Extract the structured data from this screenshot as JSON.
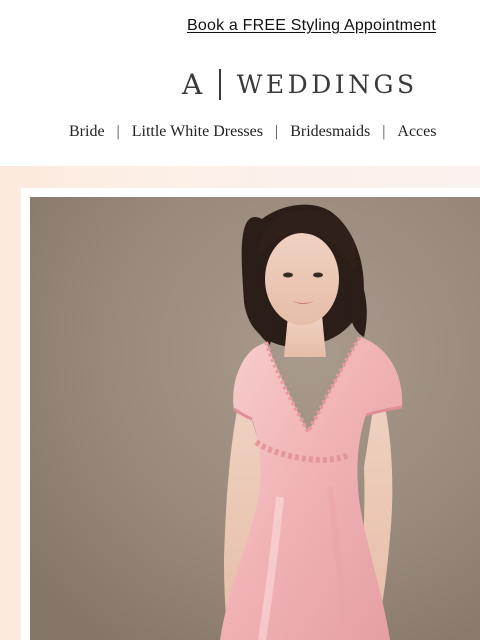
{
  "promo": {
    "link_text": "Book a FREE Styling Appointment"
  },
  "brand": {
    "mark": "A",
    "wordmark": "WEDDINGS"
  },
  "nav": {
    "items": [
      "Bride",
      "Little White Dresses",
      "Bridesmaids",
      "Acces"
    ]
  },
  "colors": {
    "backdrop": "#9a8b7f",
    "dress": "#f2b9bb",
    "hero_tint": "#fce9dd"
  }
}
